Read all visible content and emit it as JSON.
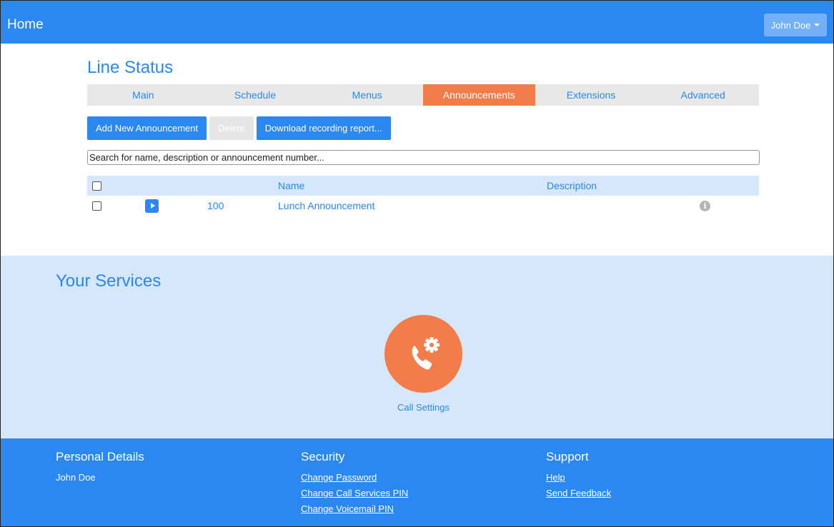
{
  "header": {
    "home_label": "Home",
    "user_label": "John Doe"
  },
  "main": {
    "title": "Line Status",
    "tabs": [
      {
        "label": "Main",
        "active": false
      },
      {
        "label": "Schedule",
        "active": false
      },
      {
        "label": "Menus",
        "active": false
      },
      {
        "label": "Announcements",
        "active": true
      },
      {
        "label": "Extensions",
        "active": false
      },
      {
        "label": "Advanced",
        "active": false
      }
    ],
    "actions": {
      "add_label": "Add New Announcement",
      "delete_label": "Delete",
      "download_label": "Download recording report..."
    },
    "search": {
      "placeholder": "Search for name, description or announcement number..."
    },
    "table": {
      "columns": {
        "name": "Name",
        "description": "Description"
      },
      "rows": [
        {
          "number": "100",
          "name": "Lunch Announcement",
          "description": ""
        }
      ]
    }
  },
  "services": {
    "title": "Your Services",
    "items": [
      {
        "label": "Call Settings",
        "icon": "phone-gear-icon"
      }
    ]
  },
  "footer": {
    "personal": {
      "title": "Personal Details",
      "name": "John Doe"
    },
    "security": {
      "title": "Security",
      "links": [
        "Change Password",
        "Change Call Services PIN",
        "Change Voicemail PIN"
      ]
    },
    "support": {
      "title": "Support",
      "links": [
        "Help",
        "Send Feedback"
      ]
    }
  },
  "colors": {
    "primary": "#2b88f0",
    "accent": "#f27d4a",
    "light": "#d6e7fb"
  }
}
